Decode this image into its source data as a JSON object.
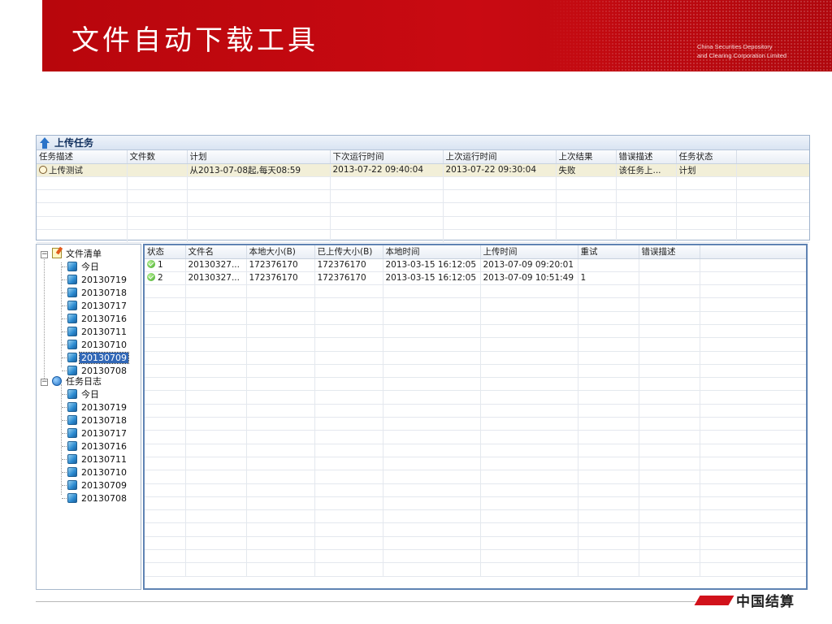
{
  "banner": {
    "title": "文件自动下载工具",
    "org_line1": "China Securities Depository",
    "org_line2": "and Clearing Corporation Limited"
  },
  "upload_tasks": {
    "title": "上传任务",
    "columns": [
      "任务描述",
      "文件数",
      "计划",
      "下次运行时间",
      "上次运行时间",
      "上次结果",
      "错误描述",
      "任务状态",
      ""
    ],
    "rows": [
      [
        "上传测试",
        "",
        "从2013-07-08起,每天08:59",
        "2013-07-22 09:40:04",
        "2013-07-22 09:30:04",
        "失败",
        "该任务上...",
        "计划",
        ""
      ]
    ]
  },
  "tree": {
    "file_list_label": "文件清单",
    "file_list_items": [
      "今日",
      "20130719",
      "20130718",
      "20130717",
      "20130716",
      "20130711",
      "20130710",
      "20130709",
      "20130708"
    ],
    "selected_item": "20130709",
    "task_log_label": "任务日志",
    "task_log_items": [
      "今日",
      "20130719",
      "20130718",
      "20130717",
      "20130716",
      "20130711",
      "20130710",
      "20130709",
      "20130708"
    ]
  },
  "files": {
    "columns": [
      "状态",
      "文件名",
      "本地大小(B)",
      "已上传大小(B)",
      "本地时间",
      "上传时间",
      "重试",
      "错误描述",
      ""
    ],
    "rows": [
      [
        "1",
        "20130327...",
        "172376170",
        "172376170",
        "2013-03-15 16:12:05",
        "2013-07-09 09:20:01",
        "",
        "",
        ""
      ],
      [
        "2",
        "20130327...",
        "172376170",
        "172376170",
        "2013-03-15 16:12:05",
        "2013-07-09 10:51:49",
        "1",
        "",
        ""
      ]
    ]
  },
  "footer": {
    "logo_text": "中国结算"
  },
  "icons": [
    "up-arrow-icon",
    "clock-icon",
    "notes-icon",
    "book-icon",
    "info-icon",
    "ok-check-icon"
  ],
  "colors": {
    "banner_red": "#c90a12",
    "selection_blue": "#3167b6",
    "grid_border": "#5f83b3"
  }
}
